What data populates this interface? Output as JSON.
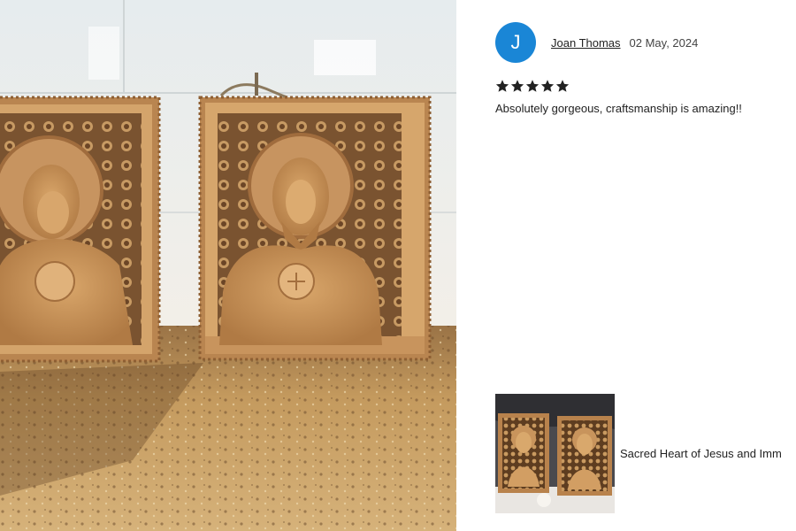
{
  "review": {
    "avatar_initial": "J",
    "reviewer_name": "Joan Thomas",
    "date": "02 May, 2024",
    "rating": 5,
    "rating_max": 5,
    "text": "Absolutely gorgeous, craftsmanship is amazing!!"
  },
  "purchased_item": {
    "title": "Sacred Heart of Jesus and Imm"
  },
  "colors": {
    "avatar_bg": "#1a86d6",
    "star": "#222222",
    "wood": "#c9935a",
    "tile_wall": "#e9ecec",
    "granite": "#c49a5e"
  }
}
